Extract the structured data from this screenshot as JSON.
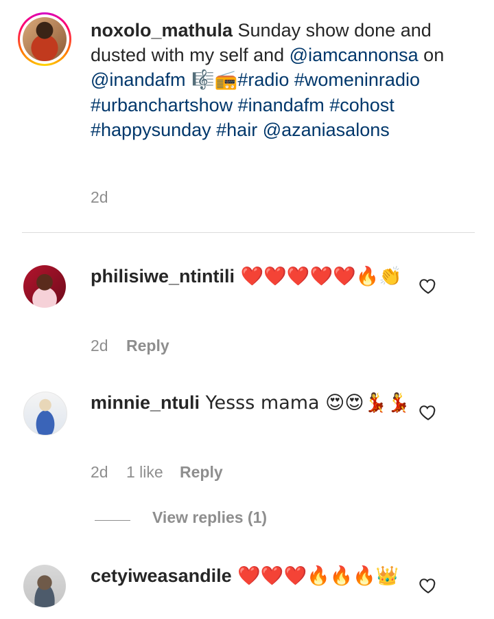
{
  "caption": {
    "username": "noxolo_mathula",
    "text_1": " Sunday show done and dusted with my self and ",
    "mention_1": "@iamcannonsa",
    "text_2": " on ",
    "mention_2": "@inandafm",
    "emojis": " 🎼📻",
    "tags": "#radio #womeninradio #urbanchartshow #inandafm #cohost #happysunday #hair",
    "mention_3": "@azaniasalons",
    "time": "2d"
  },
  "comments": [
    {
      "username": "philisiwe_ntintili",
      "text": " ❤️❤️❤️❤️❤️🔥👏",
      "time": "2d",
      "likes": "",
      "reply": "Reply"
    },
    {
      "username": "minnie_ntuli",
      "text": " Yesss mama 😍😍💃💃",
      "time": "2d",
      "likes": "1 like",
      "reply": "Reply"
    },
    {
      "username": "cetyiweasandile",
      "text": " ❤️❤️❤️🔥🔥🔥👑",
      "time": "",
      "likes": "",
      "reply": ""
    }
  ],
  "view_replies": "View replies (1)",
  "icons": {
    "like": "heart-outline-icon"
  }
}
